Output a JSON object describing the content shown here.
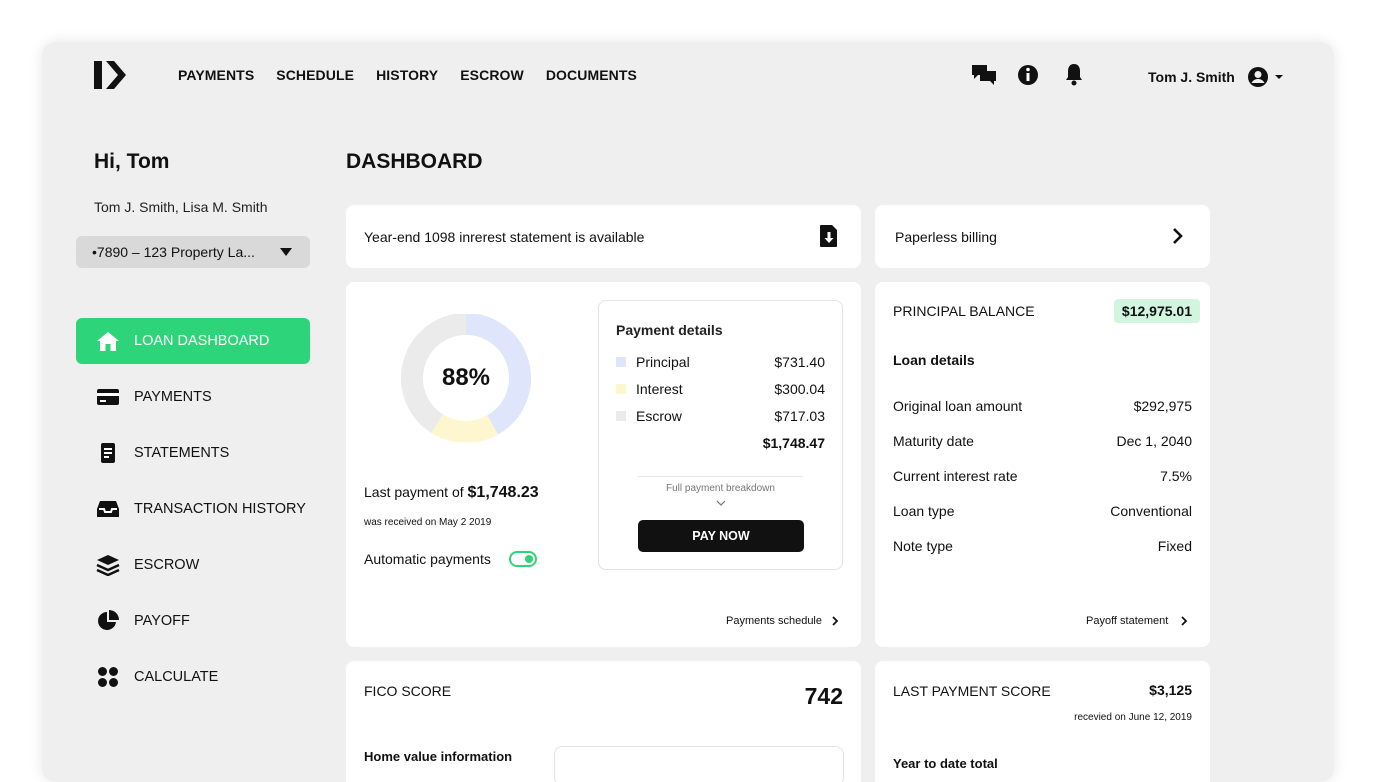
{
  "nav": {
    "items": [
      "PAYMENTS",
      "SCHEDULE",
      "HISTORY",
      "ESCROW",
      "DOCUMENTS"
    ]
  },
  "header": {
    "user_name": "Tom J. Smith"
  },
  "sidebar": {
    "greeting": "Hi, Tom",
    "owners": "Tom J. Smith, Lisa M. Smith",
    "property_select": "•7890 – 123 Property La...",
    "items": [
      {
        "label": "LOAN DASHBOARD",
        "icon": "home-icon"
      },
      {
        "label": "PAYMENTS",
        "icon": "credit-card-icon"
      },
      {
        "label": "STATEMENTS",
        "icon": "document-icon"
      },
      {
        "label": "TRANSACTION HISTORY",
        "icon": "inbox-icon"
      },
      {
        "label": "ESCROW",
        "icon": "layers-icon"
      },
      {
        "label": "PAYOFF",
        "icon": "pie-chart-icon"
      },
      {
        "label": "CALCULATE",
        "icon": "grid-icon"
      }
    ]
  },
  "main": {
    "title": "DASHBOARD",
    "statement_banner": "Year-end 1098 inrerest statement is available",
    "paperless": "Paperless billing",
    "donut": {
      "percent_label": "88%",
      "segments": [
        {
          "name": "Principal",
          "fraction": 0.418,
          "color": "#dfe6fb"
        },
        {
          "name": "Interest",
          "fraction": 0.172,
          "color": "#fdf6cf"
        },
        {
          "name": "Escrow",
          "fraction": 0.41,
          "color": "#ebebeb"
        }
      ]
    },
    "last_payment_prefix": "Last payment of",
    "last_payment_amount": "$1,748.23",
    "last_payment_date": "was received on May 2 2019",
    "auto_payments": "Automatic payments",
    "payment_details": {
      "title": "Payment details",
      "rows": [
        {
          "label": "Principal",
          "value": "$731.40",
          "color": "#dfe6fb"
        },
        {
          "label": "Interest",
          "value": "$300.04",
          "color": "#fdf6cf"
        },
        {
          "label": "Escrow",
          "value": "$717.03",
          "color": "#ebebeb"
        }
      ],
      "total": "$1,748.47",
      "breakdown": "Full payment breakdown",
      "pay_now": "PAY NOW"
    },
    "payments_schedule": "Payments schedule",
    "principal": {
      "label": "PRINCIPAL BALANCE",
      "value": "$12,975.01",
      "loan_details": "Loan details",
      "rows": [
        {
          "label": "Original loan amount",
          "value": "$292,975"
        },
        {
          "label": "Maturity date",
          "value": "Dec 1, 2040"
        },
        {
          "label": "Current interest rate",
          "value": "7.5%"
        },
        {
          "label": "Loan type",
          "value": "Conventional"
        },
        {
          "label": "Note  type",
          "value": "Fixed"
        }
      ],
      "payoff_link": "Payoff statement"
    },
    "fico": {
      "label": "FICO SCORE",
      "value": "742",
      "home_value": "Home value information"
    },
    "last_payment_score": {
      "label": "LAST PAYMENT SCORE",
      "value": "$3,125",
      "date": "recevied on June 12, 2019"
    },
    "year_total_partial": "Year to date total"
  }
}
